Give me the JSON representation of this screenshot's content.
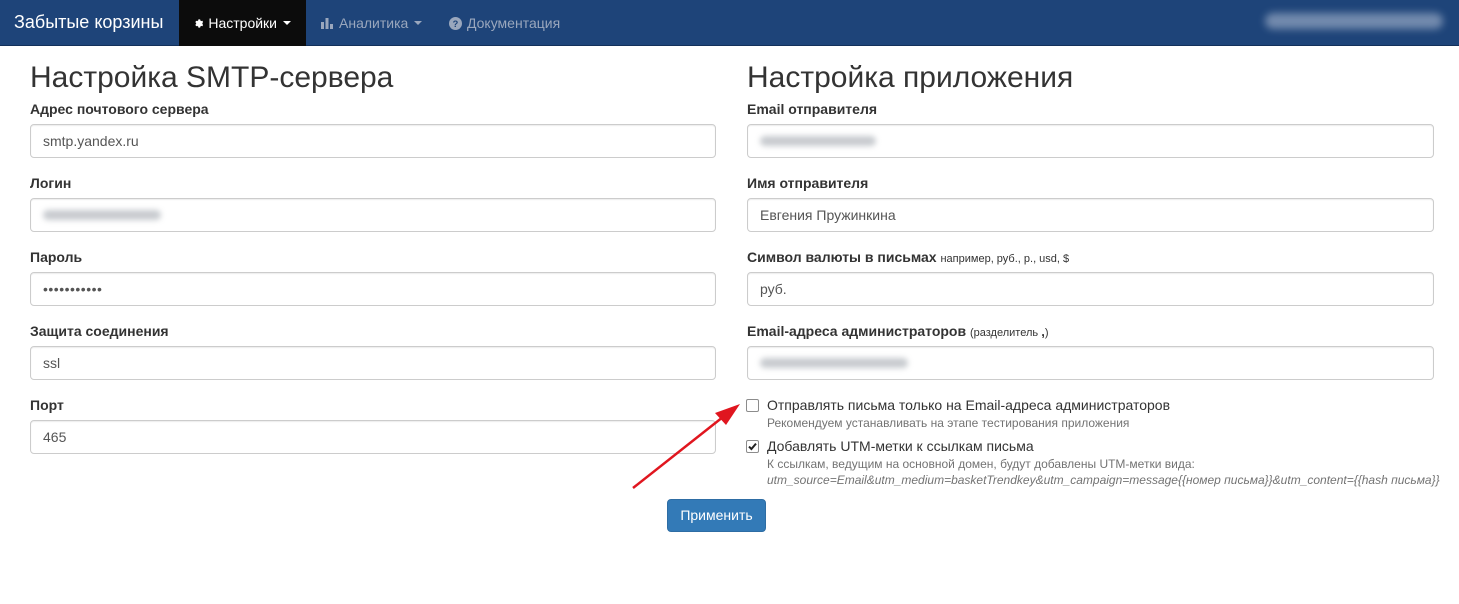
{
  "navbar": {
    "brand": "Забытые корзины",
    "items": [
      {
        "label": "Настройки",
        "icon": "gear-icon",
        "dropdown": true,
        "active": true
      },
      {
        "label": "Аналитика",
        "icon": "bar-chart-icon",
        "dropdown": true,
        "active": false
      },
      {
        "label": "Документация",
        "icon": "question-circle-icon",
        "dropdown": false,
        "active": false
      }
    ]
  },
  "smtp": {
    "title": "Настройка SMTP-сервера",
    "host_label": "Адрес почтового сервера",
    "host_value": "smtp.yandex.ru",
    "login_label": "Логин",
    "password_label": "Пароль",
    "password_value": "•••••••••••",
    "security_label": "Защита соединения",
    "security_value": "ssl",
    "port_label": "Порт",
    "port_value": "465"
  },
  "app": {
    "title": "Настройка приложения",
    "sender_email_label": "Email отправителя",
    "sender_name_label": "Имя отправителя",
    "sender_name_value": "Евгения Пружинкина",
    "currency_label": "Символ валюты в письмах",
    "currency_hint": "например, руб., р., usd, $",
    "currency_value": "руб.",
    "admin_emails_label": "Email-адреса администраторов",
    "admin_emails_hint_prefix": "(разделитель",
    "admin_emails_hint_sep": ",",
    "admin_emails_hint_suffix": ")",
    "only_admins_label": "Отправлять письма только на Email-адреса администраторов",
    "only_admins_help": "Рекомендуем устанавливать на этапе тестирования приложения",
    "only_admins_checked": false,
    "utm_label": "Добавлять UTM-метки к ссылкам письма",
    "utm_help": "К ссылкам, ведущим на основной домен, будут добавлены UTM-метки вида:",
    "utm_example": "utm_source=Email&utm_medium=basketTrendkey&utm_campaign=message{{номер письма}}&utm_content={{hash письма}}",
    "utm_checked": true
  },
  "apply_button": "Применить",
  "colors": {
    "navbar": "#1e4479",
    "active_nav": "#0c0c0c",
    "primary_button": "#337ab7",
    "annotation_arrow": "#e0161f"
  }
}
